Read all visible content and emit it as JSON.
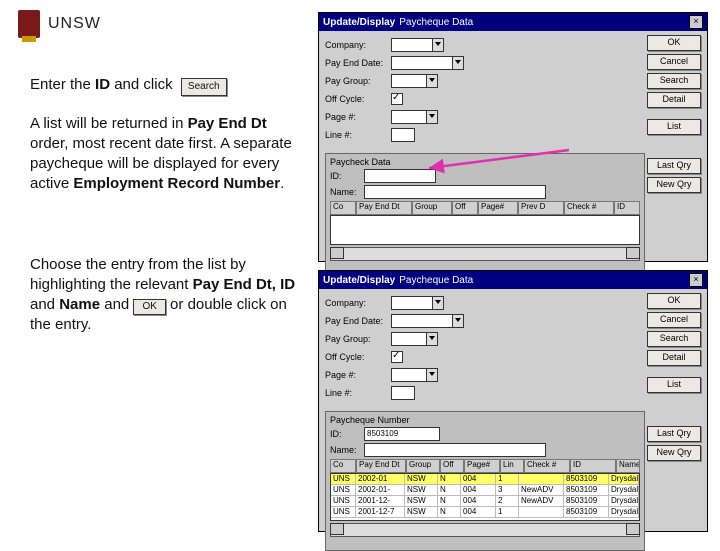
{
  "logo": {
    "text": "UNSW"
  },
  "instructions": {
    "p1a": "Enter the ",
    "p1b": "ID",
    "p1c": " and click",
    "search_btn": "Search",
    "p2a": "A list will be returned in ",
    "p2b": "Pay End Dt",
    "p2c": " order, most recent date first. A separate paycheque will be displayed for every active ",
    "p2d": "Employment Record Number",
    "p2e": ".",
    "p3a": "Choose the entry from the list by highlighting the relevant ",
    "p3b": "Pay End Dt, ID",
    "p3c": " and ",
    "p3d": "Name",
    "p3e": " and ",
    "ok_btn": "OK",
    "p3f": " or double click on the entry."
  },
  "win1": {
    "title_a": "Update/Display",
    "title_b": "Paycheque Data",
    "buttons": {
      "ok": "OK",
      "cancel": "Cancel",
      "search": "Search",
      "detail": "Detail",
      "list": "List",
      "last_qry": "Last Qry",
      "new_qry": "New Qry"
    },
    "fields": {
      "company": "Company:",
      "pay_end": "Pay End Date:",
      "pay_group": "Pay Group:",
      "off_cycle": "Off Cycle:",
      "page": "Page #:",
      "line": "Line #:"
    },
    "sub": {
      "title": "Paycheck Data",
      "id_lbl": "ID:",
      "name_lbl": "Name:",
      "cols": {
        "c0": "Co",
        "c1": "Pay End Dt",
        "c2": "Group",
        "c3": "Off",
        "c4": "Page#",
        "c5": "Prev D",
        "c6": "Check #",
        "c7": "ID"
      }
    }
  },
  "win2": {
    "title_a": "Update/Display",
    "title_b": "Paycheque Data",
    "buttons": {
      "ok": "OK",
      "cancel": "Cancel",
      "search": "Search",
      "detail": "Detail",
      "list": "List",
      "last_qry": "Last Qry",
      "new_qry": "New Qry"
    },
    "fields": {
      "company": "Company:",
      "pay_end": "Pay End Date:",
      "pay_group": "Pay Group:",
      "off_cycle": "Off Cycle:",
      "page": "Page #:",
      "line": "Line #:"
    },
    "sub": {
      "title": "Paycheque Number",
      "id_lbl": "ID:",
      "id_val": "8503109",
      "name_lbl": "Name:",
      "cols": {
        "c0": "Co",
        "c1": "Pay End Dt",
        "c2": "Group",
        "c3": "Off",
        "c4": "Page#",
        "c5": "Lin",
        "c6": "Check #",
        "c7": "ID",
        "c8": "Name"
      },
      "rows": [
        {
          "c0": "UNS",
          "c1": "2002-01",
          "c2": "NSW",
          "c3": "N",
          "c4": "004",
          "c5": "1",
          "c6": "",
          "c7": "8503109",
          "c8": "Drysdale,Democrat"
        },
        {
          "c0": "UNS",
          "c1": "2002-01-",
          "c2": "NSW",
          "c3": "N",
          "c4": "004",
          "c5": "3",
          "c6": "NewADV",
          "c7": "8503109",
          "c8": "Drysdale,Democrat"
        },
        {
          "c0": "UNS",
          "c1": "2001-12-",
          "c2": "NSW",
          "c3": "N",
          "c4": "004",
          "c5": "2",
          "c6": "NewADV",
          "c7": "8503109",
          "c8": "Drysdale,Democrat"
        },
        {
          "c0": "UNS",
          "c1": "2001-12-7",
          "c2": "NSW",
          "c3": "N",
          "c4": "004",
          "c5": "1",
          "c6": "",
          "c7": "8503109",
          "c8": "Drysdale,Democrat"
        }
      ]
    }
  }
}
